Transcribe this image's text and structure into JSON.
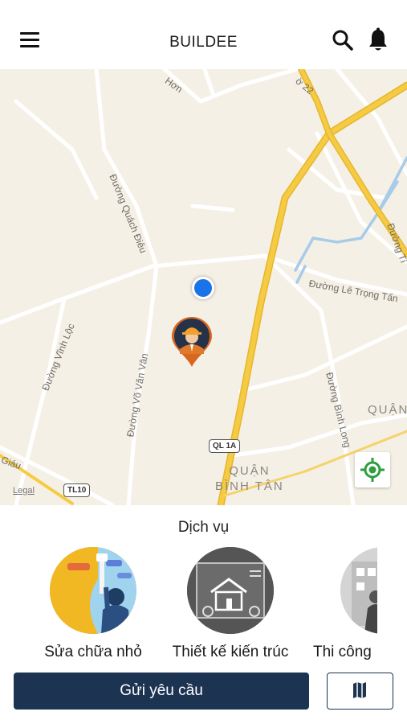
{
  "header": {
    "title": "BUILDEE",
    "menu_icon": "menu-icon",
    "search_icon": "search-icon",
    "bell_icon": "bell-icon"
  },
  "map": {
    "streets": [
      "Hơn",
      "ờ 22",
      "Đường Quách Điêu",
      "Đường Lê Trọng Tấn",
      "Đường Vĩnh Lộc",
      "Đường Võ Văn Vân",
      "Đường Bình Long",
      "Đường Tỉ",
      "Giáu"
    ],
    "districts": {
      "right": "QUẬN",
      "center_line1": "QUẬN",
      "center_line2": "BÌNH TÂN"
    },
    "shields": [
      "QL 1A",
      "TL10"
    ],
    "legal": "Legal",
    "colors": {
      "land": "#f5f0e6",
      "highway": "#f4cb42",
      "water": "#a7cbe8",
      "road": "#ffffff"
    }
  },
  "services": {
    "title": "Dịch vụ",
    "items": [
      {
        "label": "Sửa chữa nhỏ",
        "icon": "painter-icon"
      },
      {
        "label": "Thiết kế kiến trúc",
        "icon": "blueprint-house-icon"
      },
      {
        "label": "Thi công",
        "icon": "construction-icon"
      }
    ]
  },
  "actions": {
    "submit_label": "Gửi yêu cầu",
    "map_icon": "map-icon"
  },
  "colors": {
    "primary": "#1c3352",
    "accent_green": "#2e9e3e",
    "user_dot": "#1a73e8"
  }
}
